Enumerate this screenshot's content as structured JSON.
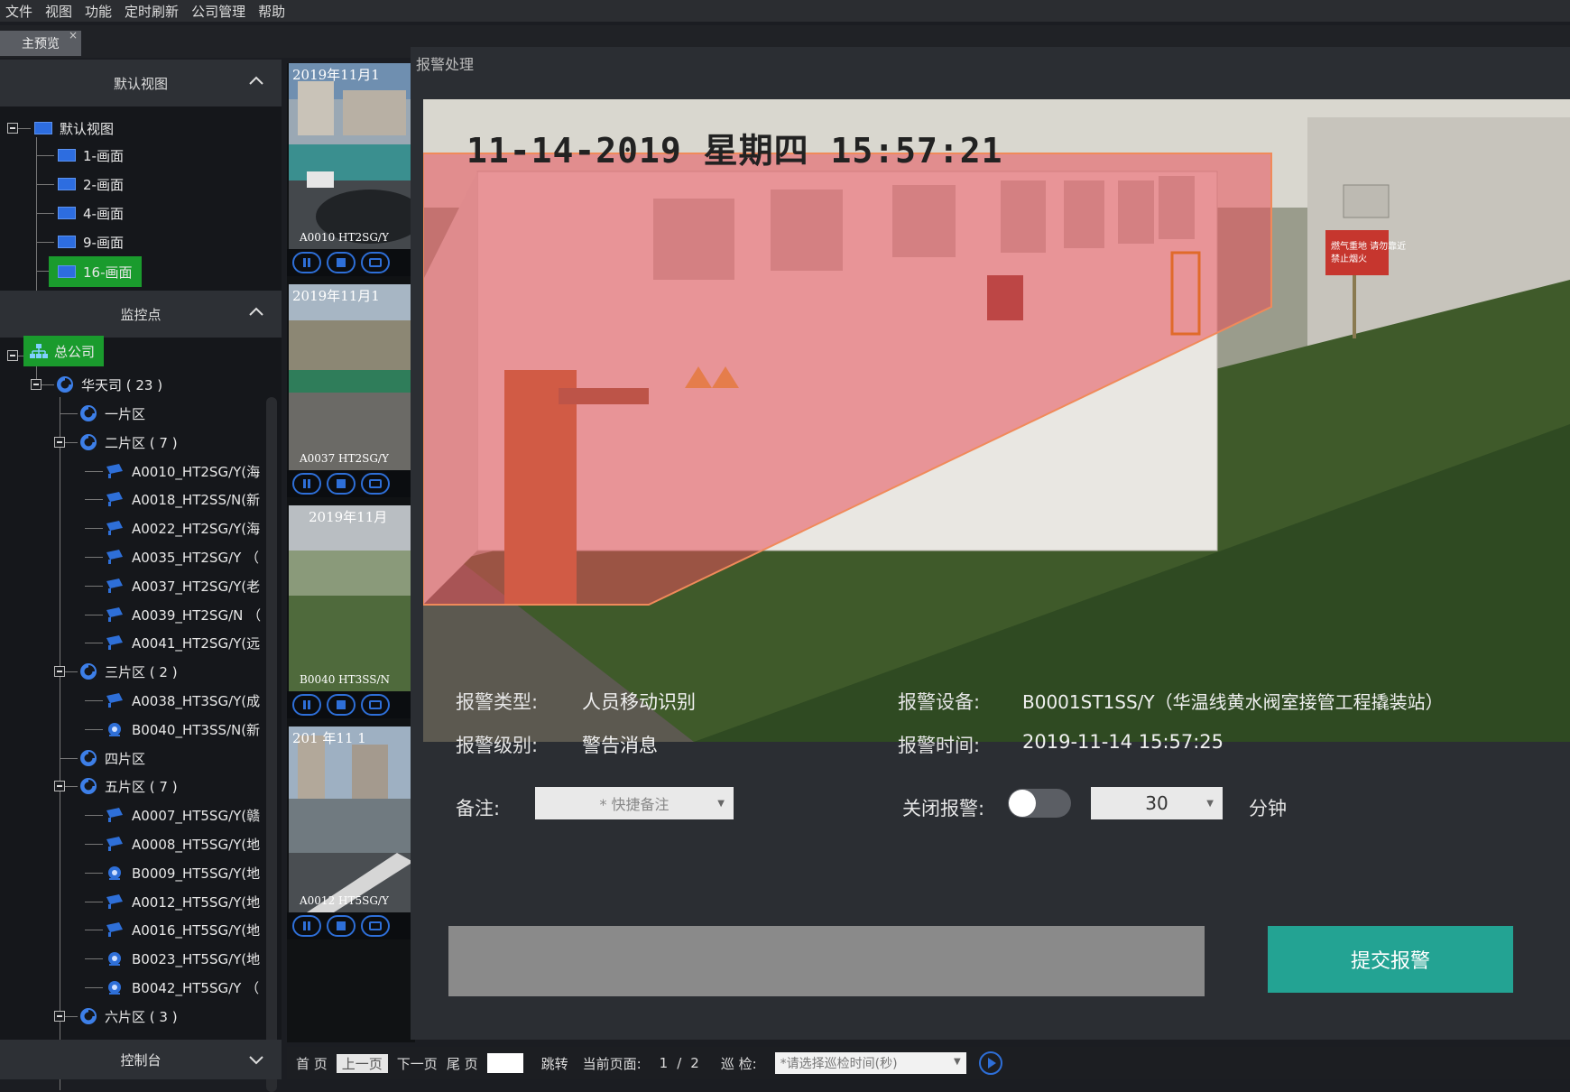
{
  "menu": [
    "文件",
    "视图",
    "功能",
    "定时刷新",
    "公司管理",
    "帮助"
  ],
  "tab": {
    "label": "主预览",
    "close": "×"
  },
  "views": {
    "header": "默认视图",
    "root": "默认视图",
    "items": [
      "1-画面",
      "2-画面",
      "4-画面",
      "9-画面",
      "16-画面"
    ]
  },
  "monitor": {
    "header": "监控点",
    "root": "总公司",
    "company": "华天司 ( 23 )",
    "nodes": [
      {
        "label": "一片区",
        "type": "region"
      },
      {
        "label": "二片区 ( 7 )",
        "type": "region"
      },
      {
        "label": "A0010_HT2SG/Y(海",
        "type": "cam"
      },
      {
        "label": "A0018_HT2SS/N(新",
        "type": "cam"
      },
      {
        "label": "A0022_HT2SG/Y(海",
        "type": "cam"
      },
      {
        "label": "A0035_HT2SG/Y （",
        "type": "cam"
      },
      {
        "label": "A0037_HT2SG/Y(老",
        "type": "cam"
      },
      {
        "label": "A0039_HT2SG/N （",
        "type": "cam"
      },
      {
        "label": "A0041_HT2SG/Y(远",
        "type": "cam"
      },
      {
        "label": "三片区 ( 2 )",
        "type": "region"
      },
      {
        "label": "A0038_HT3SG/Y(成",
        "type": "cam"
      },
      {
        "label": "B0040_HT3SS/N(新",
        "type": "dome"
      },
      {
        "label": "四片区",
        "type": "region"
      },
      {
        "label": "五片区 ( 7 )",
        "type": "region"
      },
      {
        "label": "A0007_HT5SG/Y(赣",
        "type": "cam"
      },
      {
        "label": "A0008_HT5SG/Y(地",
        "type": "cam"
      },
      {
        "label": "B0009_HT5SG/Y(地",
        "type": "dome"
      },
      {
        "label": "A0012_HT5SG/Y(地",
        "type": "cam"
      },
      {
        "label": "A0016_HT5SG/Y(地",
        "type": "cam"
      },
      {
        "label": "B0023_HT5SG/Y(地",
        "type": "dome"
      },
      {
        "label": "B0042_HT5SG/Y （",
        "type": "dome"
      },
      {
        "label": "六片区 ( 3 )",
        "type": "region"
      }
    ]
  },
  "console": {
    "header": "控制台"
  },
  "thumbs": [
    {
      "ts": "2019年11月1",
      "cap": "A0010 HT2SG/Y"
    },
    {
      "ts": "2019年11月1",
      "cap": "A0037 HT2SG/Y"
    },
    {
      "ts": "2019年11月",
      "cap": "B0040 HT3SS/N"
    },
    {
      "ts": "201 年11 1",
      "cap": "A0012 HT5SG/Y"
    }
  ],
  "alarm": {
    "title": "报警处理",
    "osd": "11-14-2019 星期四 15:57:21",
    "type_label": "报警类型:",
    "type_value": "人员移动识别",
    "device_label": "报警设备:",
    "device_value": "B0001ST1SS/Y（华温线黄水阀室接管工程撬装站）",
    "level_label": "报警级别:",
    "level_value": "警告消息",
    "time_label": "报警时间:",
    "time_value": "2019-11-14 15:57:25",
    "note_label": "备注:",
    "note_placeholder": "* 快捷备注",
    "close_label": "关闭报警:",
    "close_minutes": "30",
    "minutes_unit": "分钟",
    "submit": "提交报警",
    "sign_text": "燃气重地 请勿靠近 禁止烟火"
  },
  "bottom": {
    "first": "首 页",
    "prev": "上一页",
    "next": "下一页",
    "last": "尾 页",
    "jump": "跳转",
    "current_label": "当前页面:",
    "current_page": "1",
    "sep": "/",
    "total_pages": "2",
    "patrol_label": "巡 检:",
    "patrol_placeholder": "*请选择巡检时间(秒)"
  },
  "colors": {
    "accent": "#23a393",
    "selected": "#1a9b2d",
    "icon_blue": "#2e6fd8",
    "alarm_zone": "#e8505a"
  }
}
